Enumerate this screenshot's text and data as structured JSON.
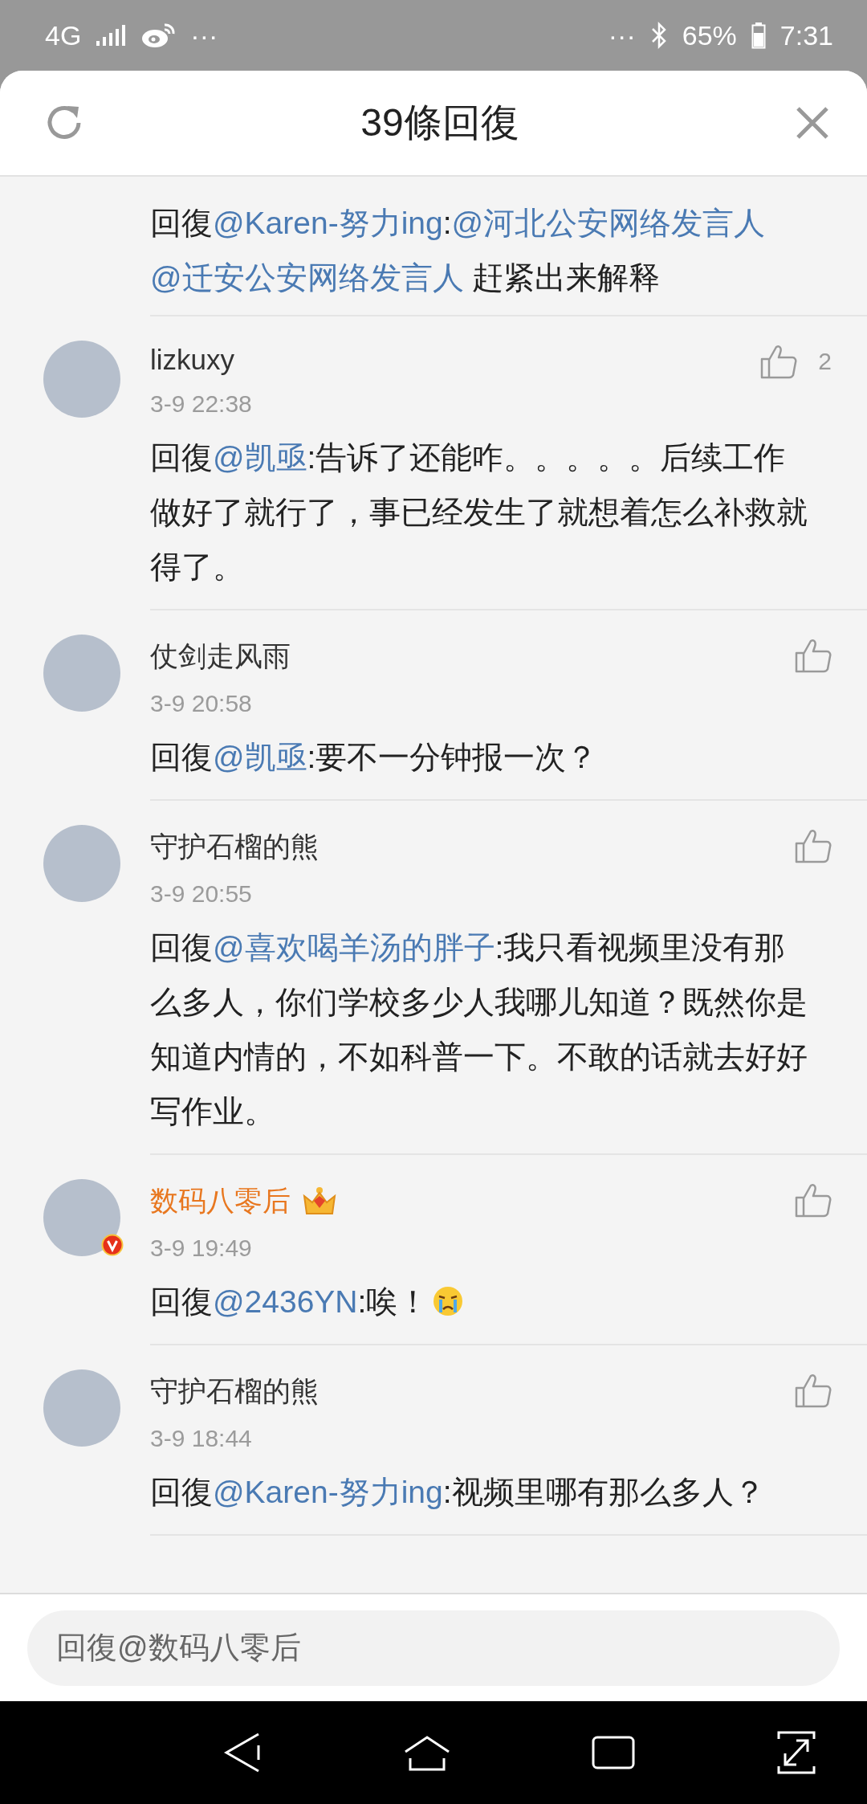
{
  "status_bar": {
    "network": "4G",
    "left_more": "···",
    "right_more": "···",
    "battery": "65%",
    "time": "7:31"
  },
  "header": {
    "title": "39條回復"
  },
  "comments": [
    {
      "body": [
        {
          "kind": "text",
          "text": "回復"
        },
        {
          "kind": "mention",
          "text": "@Karen-努力ing"
        },
        {
          "kind": "text",
          "text": ":"
        },
        {
          "kind": "mention",
          "text": "@河北公安网络发言人"
        },
        {
          "kind": "mention",
          "text": "@迁安公安网络发言人"
        },
        {
          "kind": "text",
          "text": " 赶紧出来解释"
        }
      ]
    },
    {
      "name": "lizkuxy",
      "vip": false,
      "verified": false,
      "time": "3-9 22:38",
      "likes": "2",
      "body": [
        {
          "kind": "text",
          "text": "回復"
        },
        {
          "kind": "mention",
          "text": "@凯亟"
        },
        {
          "kind": "text",
          "text": ":告诉了还能咋。。。。。后续工作做好了就行了，事已经发生了就想着怎么补救就得了。"
        }
      ]
    },
    {
      "name": "仗剑走风雨",
      "vip": false,
      "verified": false,
      "time": "3-9 20:58",
      "body": [
        {
          "kind": "text",
          "text": "回復"
        },
        {
          "kind": "mention",
          "text": "@凯亟"
        },
        {
          "kind": "text",
          "text": ":要不一分钟报一次？"
        }
      ]
    },
    {
      "name": "守护石榴的熊",
      "vip": false,
      "verified": false,
      "time": "3-9 20:55",
      "body": [
        {
          "kind": "text",
          "text": "回復"
        },
        {
          "kind": "mention",
          "text": "@喜欢喝羊汤的胖子"
        },
        {
          "kind": "text",
          "text": ":我只看视频里没有那么多人，你们学校多少人我哪儿知道？既然你是知道内情的，不如科普一下。不敢的话就去好好写作业。"
        }
      ]
    },
    {
      "name": "数码八零后",
      "vip": true,
      "verified": true,
      "time": "3-9 19:49",
      "body": [
        {
          "kind": "text",
          "text": "回復"
        },
        {
          "kind": "mention",
          "text": "@2436YN"
        },
        {
          "kind": "text",
          "text": ":唉！"
        },
        {
          "kind": "emoji"
        }
      ]
    },
    {
      "name": "守护石榴的熊",
      "vip": false,
      "verified": false,
      "time": "3-9 18:44",
      "body": [
        {
          "kind": "text",
          "text": "回復"
        },
        {
          "kind": "mention",
          "text": "@Karen-努力ing"
        },
        {
          "kind": "text",
          "text": ":视频里哪有那么多人？"
        }
      ]
    }
  ],
  "reply_box": {
    "placeholder": "回復@数码八零后"
  }
}
